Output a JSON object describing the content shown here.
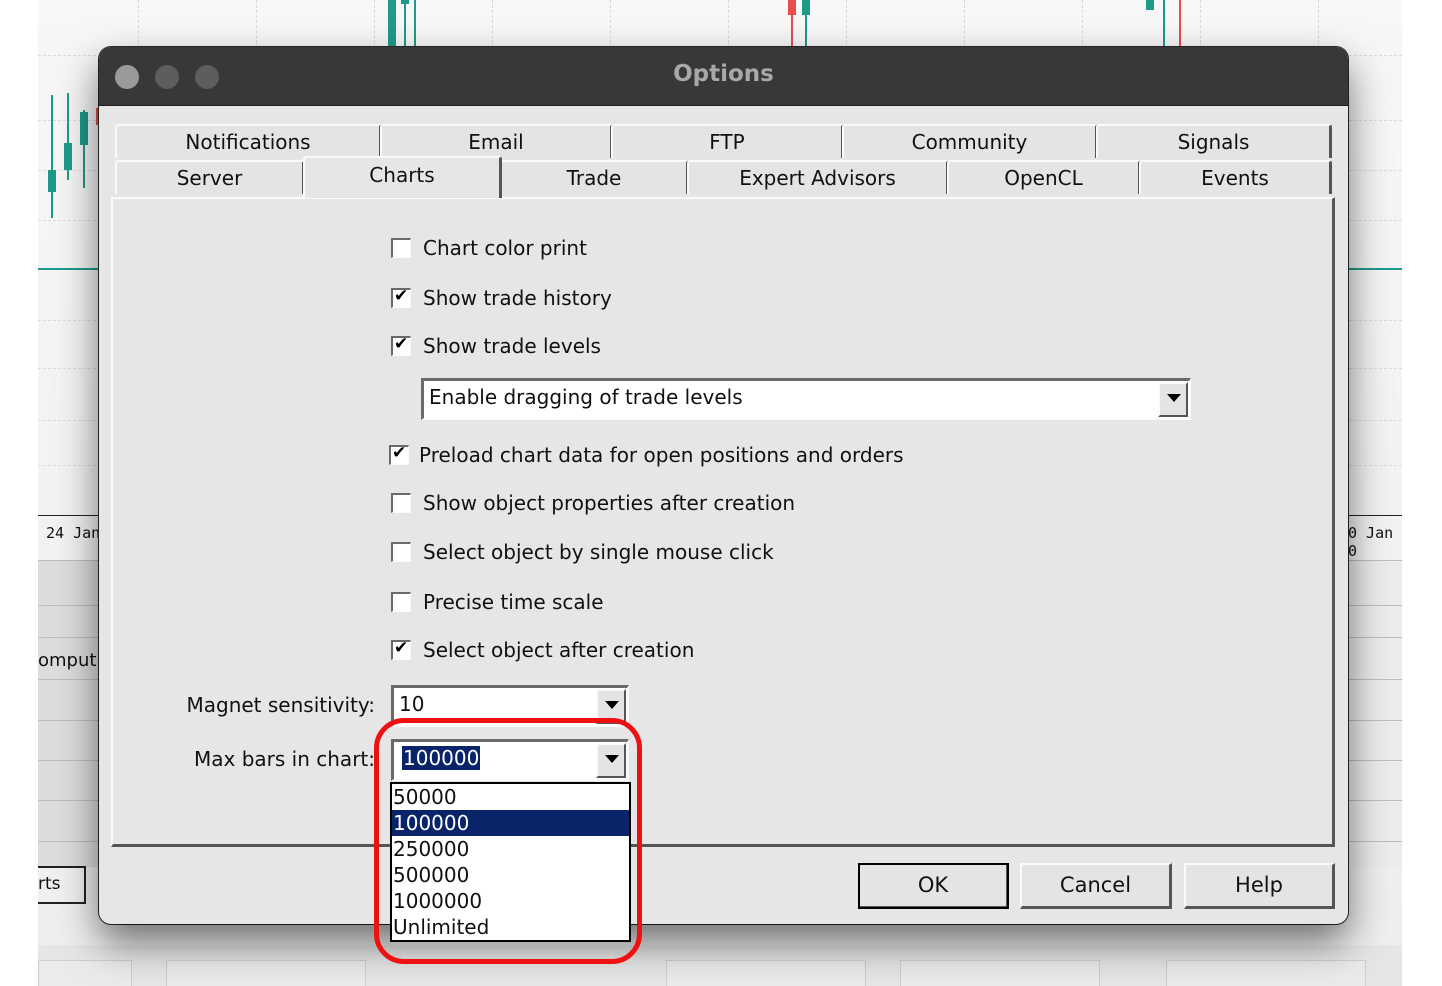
{
  "background_app": {
    "time_labels": [
      "24 Jan",
      "0 Jan 0"
    ],
    "row_fragment": "omput",
    "bottom_tab_fragment": "rts",
    "colors": {
      "bull": "#1f9a8a",
      "bear": "#e84c4c"
    }
  },
  "dialog": {
    "title": "Options",
    "tabs_row1": [
      "Notifications",
      "Email",
      "FTP",
      "Community",
      "Signals"
    ],
    "tabs_row2": [
      "Server",
      "Charts",
      "Trade",
      "Expert Advisors",
      "OpenCL",
      "Events"
    ],
    "active_tab": "Charts",
    "checkboxes": [
      {
        "label": "Chart color print",
        "checked": false
      },
      {
        "label": "Show trade history",
        "checked": true
      },
      {
        "label": "Show trade levels",
        "checked": true
      },
      {
        "label": "Preload chart data for open positions and orders",
        "checked": true
      },
      {
        "label": "Show object properties after creation",
        "checked": false
      },
      {
        "label": "Select object by single mouse click",
        "checked": false
      },
      {
        "label": "Precise time scale",
        "checked": false
      },
      {
        "label": "Select object after creation",
        "checked": true
      }
    ],
    "trade_levels_mode": {
      "value": "Enable dragging of trade levels"
    },
    "magnet_sensitivity": {
      "label": "Magnet sensitivity:",
      "value": "10"
    },
    "max_bars": {
      "label": "Max bars in chart:",
      "value": "100000",
      "options": [
        "50000",
        "100000",
        "250000",
        "500000",
        "1000000",
        "Unlimited"
      ],
      "highlighted": "100000"
    },
    "buttons": {
      "ok": "OK",
      "cancel": "Cancel",
      "help": "Help"
    },
    "annotation_color": "#ee1111"
  }
}
